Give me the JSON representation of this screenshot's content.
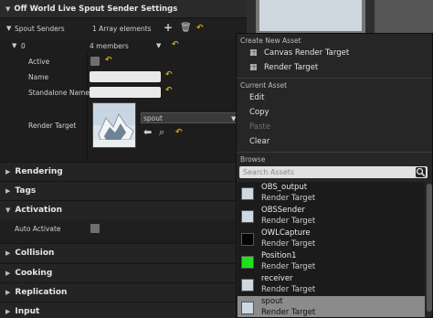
{
  "details": {
    "title": "Off World Live Spout Sender Settings",
    "spout_senders": {
      "label": "Spout Senders",
      "value": "1 Array elements"
    },
    "element0": {
      "label": "0",
      "value": "4 members"
    },
    "active": {
      "label": "Active",
      "checked": false
    },
    "name": {
      "label": "Name",
      "value": ""
    },
    "standalone_name": {
      "label": "Standalone Name",
      "value": ""
    },
    "render_target": {
      "label": "Render Target",
      "value": "spout"
    },
    "categories": {
      "rendering": "Rendering",
      "tags": "Tags",
      "activation": "Activation",
      "collision": "Collision",
      "cooking": "Cooking",
      "replication": "Replication",
      "input": "Input"
    },
    "auto_activate": {
      "label": "Auto Activate",
      "checked": false
    }
  },
  "menu": {
    "create_new_asset": {
      "header": "Create New Asset",
      "items": [
        "Canvas Render Target",
        "Render Target"
      ]
    },
    "current_asset": {
      "header": "Current Asset",
      "items": [
        {
          "label": "Edit",
          "enabled": true
        },
        {
          "label": "Copy",
          "enabled": true
        },
        {
          "label": "Paste",
          "enabled": false
        },
        {
          "label": "Clear",
          "enabled": true
        }
      ]
    },
    "browse": {
      "header": "Browse",
      "search_placeholder": "Search Assets",
      "assets": [
        {
          "name": "OBS_output",
          "type": "Render Target",
          "thumb": "snow",
          "selected": false
        },
        {
          "name": "OBSSender",
          "type": "Render Target",
          "thumb": "snow",
          "selected": false
        },
        {
          "name": "OWLCapture",
          "type": "Render Target",
          "thumb": "black",
          "selected": false
        },
        {
          "name": "Position1",
          "type": "Render Target",
          "thumb": "green",
          "selected": false
        },
        {
          "name": "receiver",
          "type": "Render Target",
          "thumb": "snow",
          "selected": false
        },
        {
          "name": "spout",
          "type": "Render Target",
          "thumb": "snow",
          "selected": true
        }
      ]
    }
  },
  "colors": {
    "accent_reset": "#d9b000",
    "selection": "#8b8b8b",
    "green_thumb": "#1fe21f"
  },
  "icons": {
    "collapse": "triangle-down-icon",
    "add": "plus-icon",
    "delete": "trash-icon",
    "reset": "reset-arrow-icon",
    "use_selected": "arrow-left-icon",
    "browse": "magnifier-icon",
    "search": "search-icon"
  }
}
